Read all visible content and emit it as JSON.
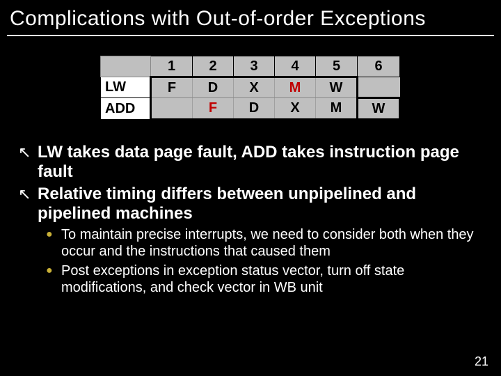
{
  "title": "Complications with Out-of-order Exceptions",
  "table": {
    "cols": [
      "1",
      "2",
      "3",
      "4",
      "5",
      "6"
    ],
    "rows": [
      {
        "label": "LW",
        "cells": [
          "F",
          "D",
          "X",
          "M",
          "W",
          ""
        ],
        "red_index": 3
      },
      {
        "label": "ADD",
        "cells": [
          "",
          "F",
          "D",
          "X",
          "M",
          "W"
        ],
        "red_index": 1
      }
    ]
  },
  "bullets": {
    "level1": [
      "LW takes data page fault, ADD takes instruction page fault",
      "Relative timing differs between unpipelined and pipelined machines"
    ],
    "level2": [
      "To maintain precise interrupts, we need to consider both when they occur and the instructions that caused them",
      "Post exceptions in exception status vector, turn off state modifications, and check vector in WB unit"
    ]
  },
  "bullet_marks": {
    "l1": "↖",
    "l2": "●"
  },
  "page_number": "21"
}
